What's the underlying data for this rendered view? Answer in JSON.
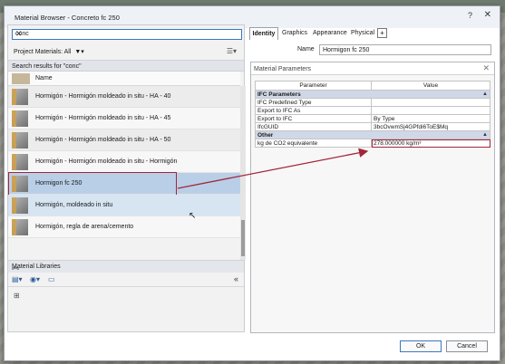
{
  "window": {
    "title": "Material Browser - Concreto fc 250",
    "help": "?",
    "close": "✕"
  },
  "search": {
    "value": "conc"
  },
  "project_materials": {
    "label": "Project Materials: All"
  },
  "results_header": "Search results for \"conc\"",
  "columns": {
    "name": "Name"
  },
  "materials": [
    {
      "label": "Hormigón - Hormigón moldeado in situ - HA - 40"
    },
    {
      "label": "Hormigón - Hormigón moldeado in situ - HA - 45"
    },
    {
      "label": "Hormigón - Hormigón moldeado in situ - HA - 50"
    },
    {
      "label": "Hormigón - Hormigón moldeado in situ - Hormigón"
    },
    {
      "label": "Hormigon fc 250"
    },
    {
      "label": "Hormigón, moldeado in situ"
    },
    {
      "label": "Hormigón, regla de arena/cemento"
    }
  ],
  "libraries": {
    "label": "Material Libraries"
  },
  "tabs": [
    {
      "label": "Identity"
    },
    {
      "label": "Graphics"
    },
    {
      "label": "Appearance"
    },
    {
      "label": "Physical"
    }
  ],
  "name_field": {
    "label": "Name",
    "value": "Hormigon fc 250"
  },
  "params_panel": {
    "title": "Material Parameters",
    "columns": {
      "parameter": "Parameter",
      "value": "Value"
    },
    "groups": [
      {
        "name": "IFC Parameters",
        "rows": [
          {
            "p": "IFC Predefined Type",
            "v": ""
          },
          {
            "p": "Export to IFC As",
            "v": ""
          },
          {
            "p": "Export to IFC",
            "v": "By Type"
          },
          {
            "p": "IfcGUID",
            "v": "3bcOvwmSj4GPfdi6ToE$Mq"
          }
        ]
      },
      {
        "name": "Other",
        "rows": [
          {
            "p": "kg de CO2 equivalente",
            "v": "278.000000 kg/m³"
          }
        ]
      }
    ]
  },
  "buttons": {
    "ok": "OK",
    "cancel": "Cancel"
  },
  "colors": {
    "highlight": "#a3253a",
    "selected_row": "#b9cfe7",
    "accent": "#3c78c0"
  }
}
